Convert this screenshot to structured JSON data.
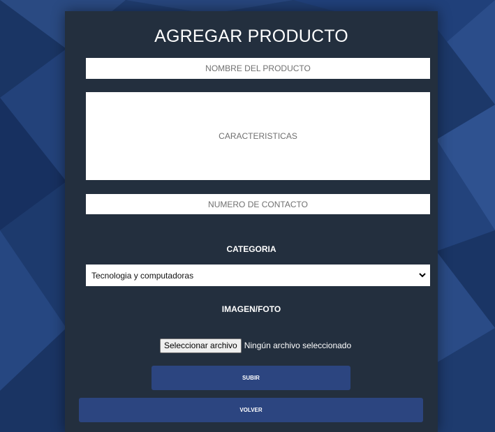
{
  "form": {
    "title": "AGREGAR PRODUCTO",
    "name_placeholder": "NOMBRE DEL PRODUCTO",
    "features_placeholder": "CARACTERISTICAS",
    "contact_placeholder": "NUMERO DE CONTACTO",
    "category_label": "CATEGORIA",
    "category_selected": "Tecnologia y computadoras",
    "image_label": "IMAGEN/FOTO",
    "file_button_label": "Seleccionar archivo",
    "file_status": "Ningún archivo seleccionado",
    "submit_label": "SUBIR",
    "back_label": "VOLVER"
  },
  "colors": {
    "background": "#1e3a6b",
    "panel": "#232f3e",
    "button": "#2c4580"
  }
}
